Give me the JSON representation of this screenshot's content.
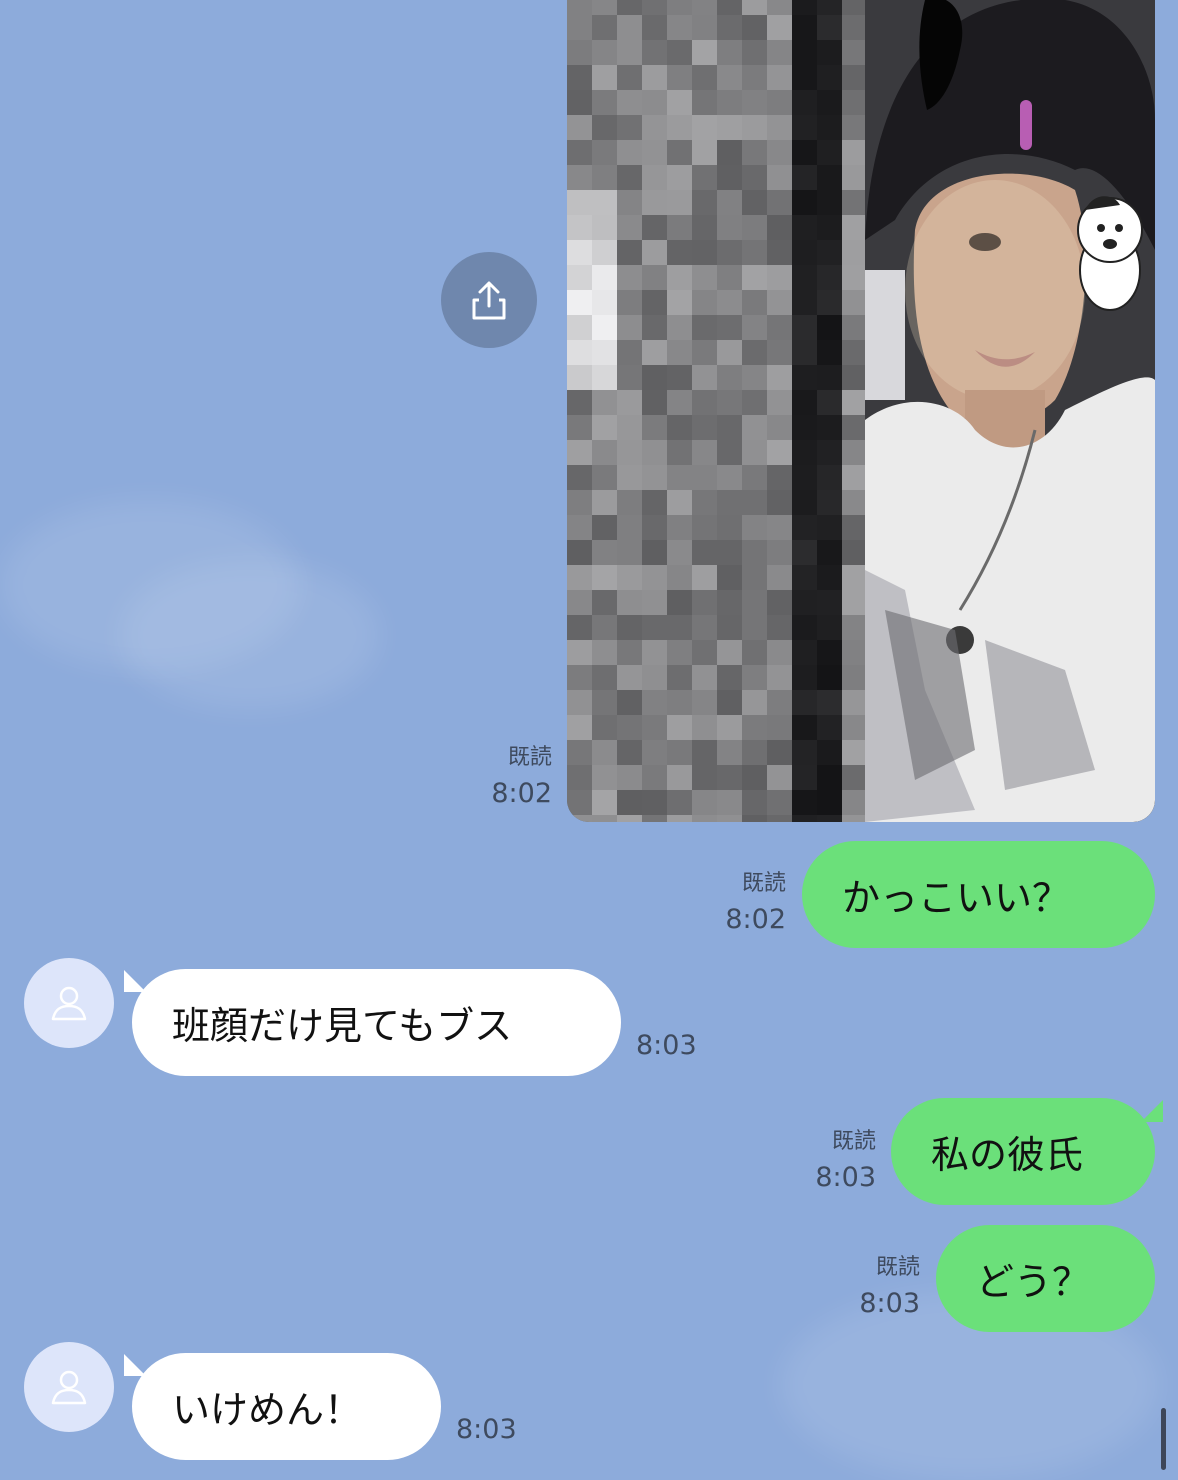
{
  "colors": {
    "background": "#8dabdb",
    "sent_bubble": "#6be07a",
    "received_bubble": "#ffffff",
    "meta_text": "#3e4a5e"
  },
  "messages": [
    {
      "type": "photo",
      "direction": "sent",
      "read": "既読",
      "time": "8:02"
    },
    {
      "type": "text",
      "direction": "sent",
      "text": "かっこいい？",
      "read": "既読",
      "time": "8:02"
    },
    {
      "type": "text",
      "direction": "received",
      "text": "班顔だけ見てもブス",
      "time": "8:03"
    },
    {
      "type": "text",
      "direction": "sent",
      "text": "私の彼氏",
      "read": "既読",
      "time": "8:03"
    },
    {
      "type": "text",
      "direction": "sent",
      "text": "どう？",
      "read": "既読",
      "time": "8:03"
    },
    {
      "type": "text",
      "direction": "received",
      "text": "いけめん！",
      "time": "8:03"
    }
  ],
  "icons": {
    "share": "share-icon",
    "avatar": "default-avatar-icon"
  }
}
